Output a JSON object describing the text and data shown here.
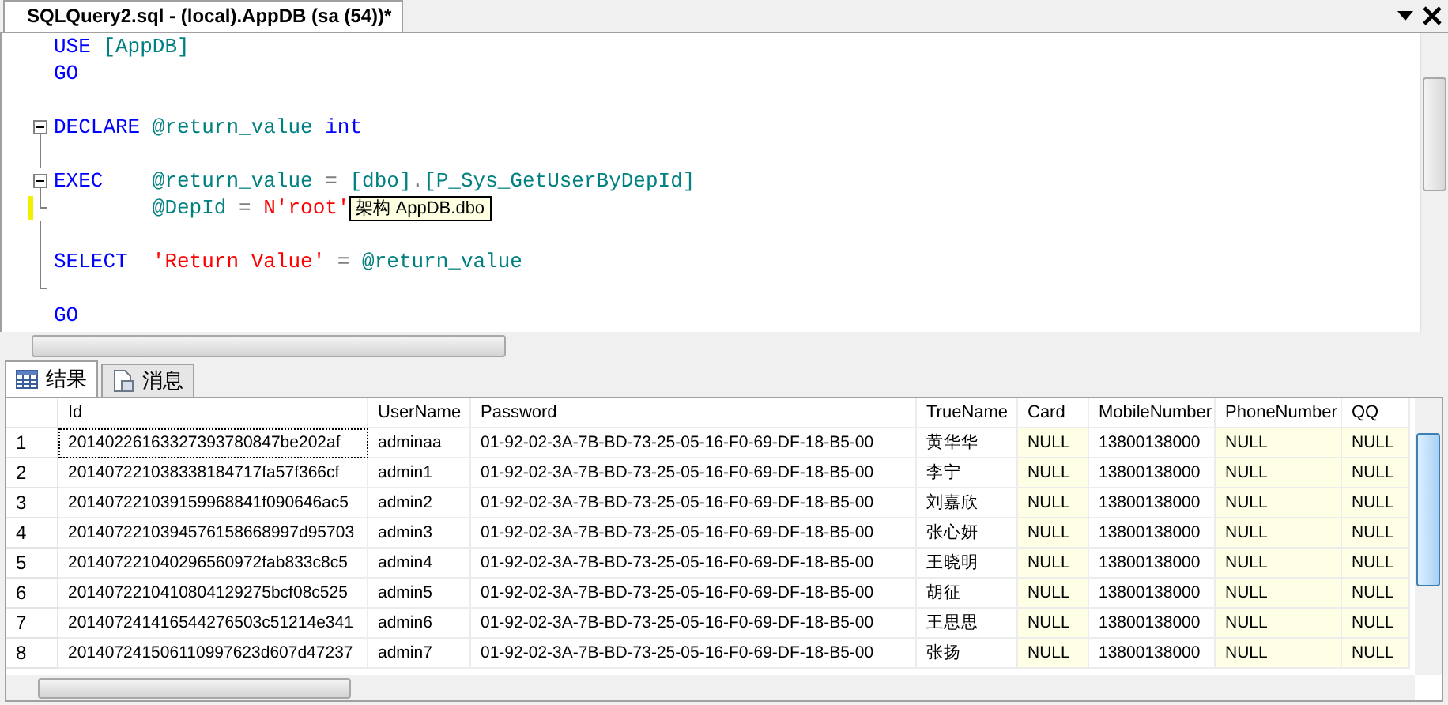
{
  "document_tab": {
    "title": "SQLQuery2.sql - (local).AppDB (sa (54))*"
  },
  "editor": {
    "lines": [
      {
        "kind": "simple",
        "fold_start": false,
        "fold_end": false,
        "changed": false,
        "tokens": [
          {
            "text": "USE",
            "kind": "keyword"
          },
          {
            "text": "[AppDB]",
            "kind": "ident"
          }
        ]
      },
      {
        "kind": "simple",
        "fold_start": false,
        "fold_end": false,
        "changed": false,
        "tokens": [
          {
            "text": "GO",
            "kind": "keyword"
          }
        ]
      },
      {
        "kind": "blank",
        "fold_start": false,
        "fold_end": false,
        "changed": false
      },
      {
        "kind": "aligned",
        "fold_start": true,
        "fold_end": false,
        "changed": false,
        "tokens": [
          {
            "text": "DECLARE",
            "kind": "keyword"
          },
          {
            "text": "@return_value",
            "kind": "variable"
          },
          {
            "text": "int",
            "kind": "keyword"
          }
        ]
      },
      {
        "kind": "blank",
        "fold_start": false,
        "fold_end": false,
        "changed": false
      },
      {
        "kind": "aligned",
        "fold_start": true,
        "fold_end": false,
        "changed": false,
        "tokens": [
          {
            "text": "EXEC",
            "kind": "keyword"
          },
          {
            "text": "@return_value",
            "kind": "variable"
          },
          {
            "text": "=",
            "kind": "operator"
          },
          {
            "text": "[dbo]",
            "kind": "ident"
          },
          {
            "text": ".",
            "kind": "punct"
          },
          {
            "text": "[P_Sys_GetUserByDepId]",
            "kind": "ident"
          }
        ]
      },
      {
        "kind": "continuation",
        "fold_start": false,
        "fold_end": true,
        "changed": true,
        "tooltip": "架构 AppDB.dbo",
        "tokens": [
          {
            "text": "@DepId",
            "kind": "variable"
          },
          {
            "text": "=",
            "kind": "operator"
          },
          {
            "text": "N'root'",
            "kind": "string"
          }
        ]
      },
      {
        "kind": "blank",
        "fold_start": false,
        "fold_end": false,
        "changed": false
      },
      {
        "kind": "aligned",
        "fold_start": false,
        "fold_end": false,
        "changed": false,
        "tokens": [
          {
            "text": "SELECT",
            "kind": "keyword"
          },
          {
            "text": "'Return Value'",
            "kind": "string"
          },
          {
            "text": "=",
            "kind": "operator"
          },
          {
            "text": "@return_value",
            "kind": "variable"
          }
        ]
      },
      {
        "kind": "blank",
        "fold_start": false,
        "fold_end": true,
        "changed": false
      },
      {
        "kind": "simple",
        "fold_start": false,
        "fold_end": false,
        "changed": false,
        "tokens": [
          {
            "text": "GO",
            "kind": "keyword"
          }
        ]
      }
    ]
  },
  "result_tabs": [
    {
      "label": "结果",
      "kind": "grid",
      "selected": true
    },
    {
      "label": "消息",
      "kind": "messages",
      "selected": false
    }
  ],
  "grid": {
    "columns": [
      {
        "label": "Id",
        "tinted": false
      },
      {
        "label": "UserName",
        "tinted": false
      },
      {
        "label": "Password",
        "tinted": false
      },
      {
        "label": "TrueName",
        "tinted": false
      },
      {
        "label": "Card",
        "tinted": true
      },
      {
        "label": "MobileNumber",
        "tinted": false
      },
      {
        "label": "PhoneNumber",
        "tinted": true
      },
      {
        "label": "QQ",
        "tinted": true
      }
    ],
    "rows": [
      {
        "number": "1",
        "selected": true,
        "cells": [
          "20140226163327393780847be202af",
          "adminaa",
          "01-92-02-3A-7B-BD-73-25-05-16-F0-69-DF-18-B5-00",
          "黄华华",
          "NULL",
          "13800138000",
          "NULL",
          "NULL"
        ]
      },
      {
        "number": "2",
        "selected": false,
        "cells": [
          "201407221038338184717fa57f366cf",
          "admin1",
          "01-92-02-3A-7B-BD-73-25-05-16-F0-69-DF-18-B5-00",
          "李宁",
          "NULL",
          "13800138000",
          "NULL",
          "NULL"
        ]
      },
      {
        "number": "3",
        "selected": false,
        "cells": [
          "201407221039159968841f090646ac5",
          "admin2",
          "01-92-02-3A-7B-BD-73-25-05-16-F0-69-DF-18-B5-00",
          "刘嘉欣",
          "NULL",
          "13800138000",
          "NULL",
          "NULL"
        ]
      },
      {
        "number": "4",
        "selected": false,
        "cells": [
          "2014072210394576158668997d95703",
          "admin3",
          "01-92-02-3A-7B-BD-73-25-05-16-F0-69-DF-18-B5-00",
          "张心妍",
          "NULL",
          "13800138000",
          "NULL",
          "NULL"
        ]
      },
      {
        "number": "5",
        "selected": false,
        "cells": [
          "201407221040296560972fab833c8c5",
          "admin4",
          "01-92-02-3A-7B-BD-73-25-05-16-F0-69-DF-18-B5-00",
          "王晓明",
          "NULL",
          "13800138000",
          "NULL",
          "NULL"
        ]
      },
      {
        "number": "6",
        "selected": false,
        "cells": [
          "2014072210410804129275bcf08c525",
          "admin5",
          "01-92-02-3A-7B-BD-73-25-05-16-F0-69-DF-18-B5-00",
          "胡征",
          "NULL",
          "13800138000",
          "NULL",
          "NULL"
        ]
      },
      {
        "number": "7",
        "selected": false,
        "cells": [
          "201407241416544276503c51214e341",
          "admin6",
          "01-92-02-3A-7B-BD-73-25-05-16-F0-69-DF-18-B5-00",
          "王思思",
          "NULL",
          "13800138000",
          "NULL",
          "NULL"
        ]
      },
      {
        "number": "8",
        "selected": false,
        "cells": [
          "201407241506110997623d607d47237",
          "admin7",
          "01-92-02-3A-7B-BD-73-25-05-16-F0-69-DF-18-B5-00",
          "张扬",
          "NULL",
          "13800138000",
          "NULL",
          "NULL"
        ]
      }
    ]
  }
}
